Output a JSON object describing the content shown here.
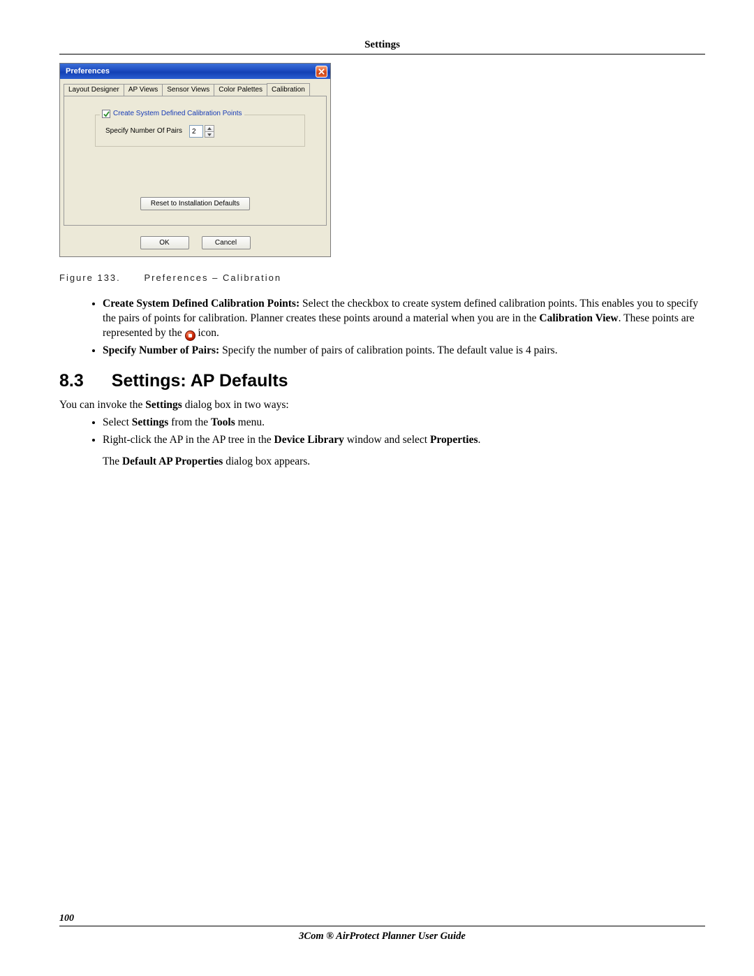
{
  "header": {
    "title": "Settings"
  },
  "dialog": {
    "title": "Preferences",
    "tabs": [
      "Layout Designer",
      "AP Views",
      "Sensor Views",
      "Color Palettes",
      "Calibration"
    ],
    "active_tab_index": 4,
    "group_legend": "Create System Defined Calibration Points",
    "checkbox_checked": true,
    "field_label": "Specify Number Of Pairs",
    "field_value": "2",
    "reset_label": "Reset to Installation Defaults",
    "ok_label": "OK",
    "cancel_label": "Cancel"
  },
  "figure": {
    "number": "Figure 133.",
    "caption": "Preferences – Calibration"
  },
  "bullets1": {
    "b1_strong": "Create System Defined Calibration Points:",
    "b1_rest1": " Select the checkbox to create system defined calibration points. This enables you to specify the pairs of points for calibration. Planner creates these points around a material when you are in the ",
    "b1_strong_inline": "Calibration View",
    "b1_rest2": ". These points are represented by the ",
    "b1_tail": " icon.",
    "b2_strong": "Specify Number of Pairs:",
    "b2_rest": " Specify the number of pairs of calibration points. The default value is 4 pairs."
  },
  "section": {
    "number": "8.3",
    "title": "Settings: AP Defaults"
  },
  "intro": {
    "pre": "You can invoke the ",
    "bold1": "Settings",
    "mid": " dialog box in two ways:"
  },
  "bullets2": {
    "i1_pre": "Select ",
    "i1_b1": "Settings",
    "i1_mid": " from the ",
    "i1_b2": "Tools",
    "i1_post": " menu.",
    "i2_pre": "Right-click the AP in the AP tree in the ",
    "i2_b1": "Device Library",
    "i2_mid": " window and select ",
    "i2_b2": "Properties",
    "i2_post": "."
  },
  "closing": {
    "pre": "The ",
    "bold": "Default AP Properties",
    "post": " dialog box appears."
  },
  "footer": {
    "page": "100",
    "title": "3Com ® AirProtect Planner User Guide"
  }
}
